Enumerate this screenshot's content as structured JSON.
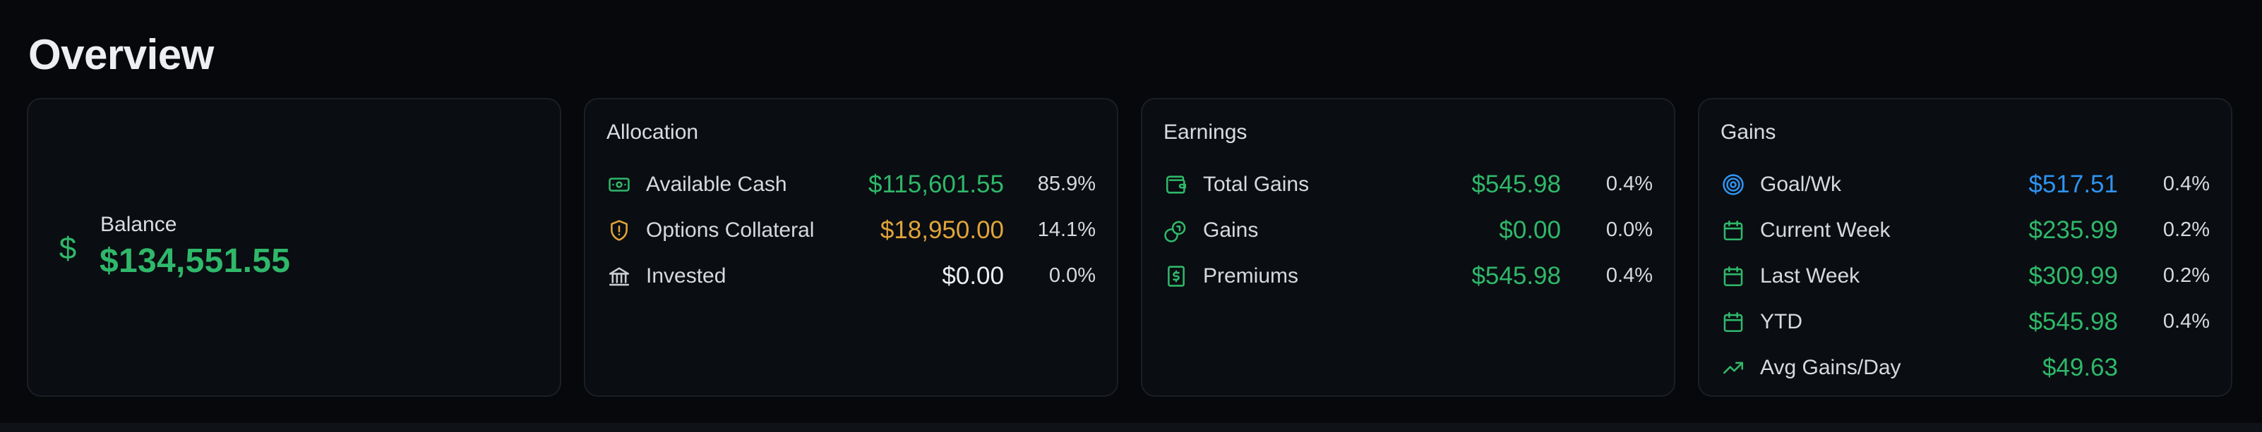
{
  "page": {
    "title": "Overview"
  },
  "balance": {
    "label": "Balance",
    "value": "$134,551.55",
    "icon": "dollar-icon"
  },
  "allocation": {
    "title": "Allocation",
    "rows": [
      {
        "icon": "cash-icon",
        "label": "Available Cash",
        "value": "$115,601.55",
        "pct": "85.9%",
        "color": "#2fb86a"
      },
      {
        "icon": "shield-icon",
        "label": "Options Collateral",
        "value": "$18,950.00",
        "pct": "14.1%",
        "color": "#e0a53a"
      },
      {
        "icon": "bank-icon",
        "label": "Invested",
        "value": "$0.00",
        "pct": "0.0%",
        "color": "#eceef1"
      }
    ]
  },
  "earnings": {
    "title": "Earnings",
    "rows": [
      {
        "icon": "wallet-icon",
        "label": "Total Gains",
        "value": "$545.98",
        "pct": "0.4%",
        "color": "#2fb86a"
      },
      {
        "icon": "coins-icon",
        "label": "Gains",
        "value": "$0.00",
        "pct": "0.0%",
        "color": "#2fb86a"
      },
      {
        "icon": "receipt-icon",
        "label": "Premiums",
        "value": "$545.98",
        "pct": "0.4%",
        "color": "#2fb86a"
      }
    ]
  },
  "gains": {
    "title": "Gains",
    "rows": [
      {
        "icon": "target-icon",
        "label": "Goal/Wk",
        "value": "$517.51",
        "pct": "0.4%",
        "color": "#2f93f0"
      },
      {
        "icon": "calendar-icon",
        "label": "Current Week",
        "value": "$235.99",
        "pct": "0.2%",
        "color": "#2fb86a"
      },
      {
        "icon": "calendar-icon",
        "label": "Last Week",
        "value": "$309.99",
        "pct": "0.2%",
        "color": "#2fb86a"
      },
      {
        "icon": "calendar-icon",
        "label": "YTD",
        "value": "$545.98",
        "pct": "0.4%",
        "color": "#2fb86a"
      },
      {
        "icon": "trend-up-icon",
        "label": "Avg Gains/Day",
        "value": "$49.63",
        "pct": "",
        "color": "#2fb86a"
      }
    ]
  },
  "colors": {
    "green": "#2fb86a",
    "amber": "#e0a53a",
    "blue": "#2f93f0",
    "background": "#06080b",
    "card": "#0a0d11"
  }
}
